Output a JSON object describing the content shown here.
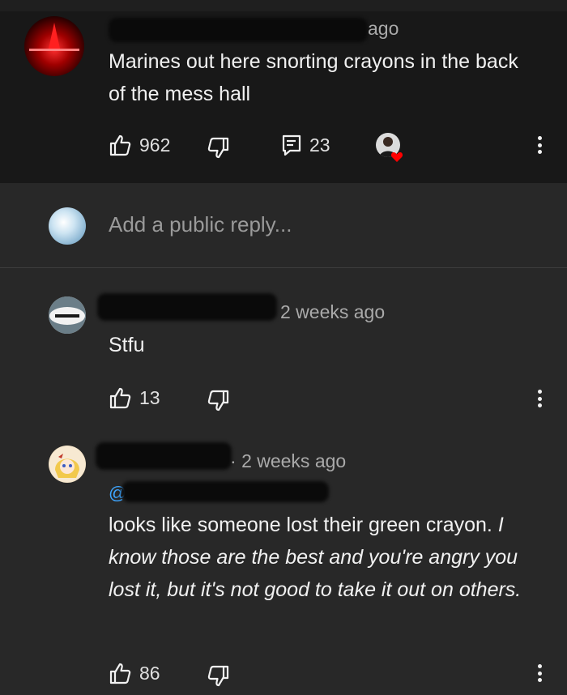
{
  "parent_comment": {
    "time_suffix": "ago",
    "text": "Marines out here snorting crayons in the back of the mess hall",
    "likes": "962",
    "replies": "23"
  },
  "reply_box": {
    "placeholder": "Add a public reply..."
  },
  "replies": [
    {
      "time": "2 weeks ago",
      "text": "Stfu",
      "likes": "13"
    },
    {
      "time": "2 weeks ago",
      "mention": "@",
      "text_normal": "looks like someone lost their green crayon.",
      "text_italic": "I know those are the best and you're angry you lost it, but it's not good to take it out on others.",
      "likes": "86"
    }
  ],
  "colors": {
    "background": "#282828",
    "parent_background": "#181818",
    "text": "#f1f1f1",
    "meta": "#aaaaaa",
    "heart": "#ff0000"
  }
}
